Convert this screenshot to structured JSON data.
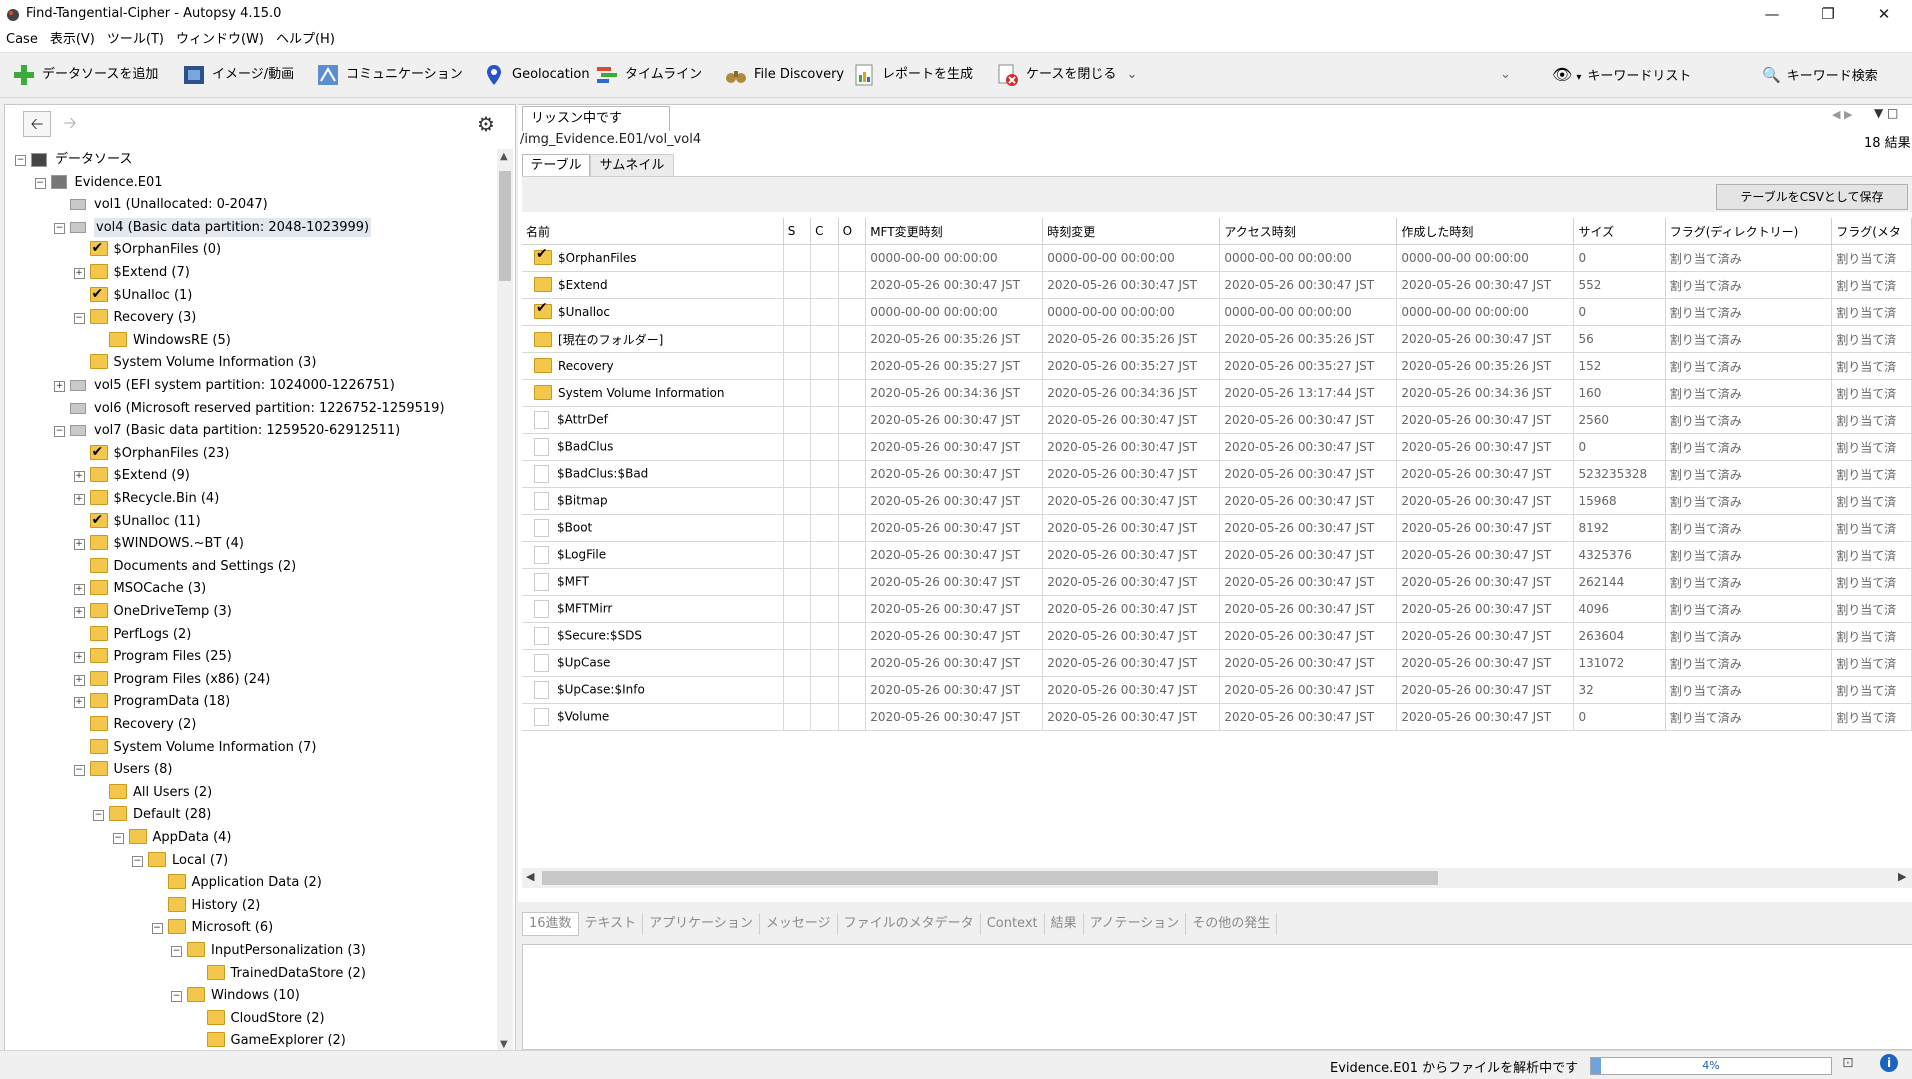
{
  "window": {
    "title": "Find-Tangential-Cipher - Autopsy 4.15.0"
  },
  "menu": [
    "Case",
    "表示(V)",
    "ツール(T)",
    "ウィンドウ(W)",
    "ヘルプ(H)"
  ],
  "toolbar": {
    "add_datasource": "データソースを追加",
    "images_videos": "イメージ/動画",
    "communications": "コミュニケーション",
    "geolocation": "Geolocation",
    "timeline": "タイムライン",
    "file_discovery": "File Discovery",
    "generate_report": "レポートを生成",
    "close_case": "ケースを閉じる",
    "keyword_list": "キーワードリスト",
    "keyword_search": "キーワード検索"
  },
  "tree": [
    {
      "label": "データソース",
      "depth": 0,
      "exp": "minus",
      "icon": "computer"
    },
    {
      "label": "Evidence.E01",
      "depth": 1,
      "exp": "minus",
      "icon": "image"
    },
    {
      "label": "vol1 (Unallocated: 0-2047)",
      "depth": 2,
      "exp": "",
      "icon": "volume"
    },
    {
      "label": "vol4 (Basic data partition: 2048-1023999)",
      "depth": 2,
      "exp": "minus",
      "icon": "volume",
      "selected": true
    },
    {
      "label": "$OrphanFiles (0)",
      "depth": 3,
      "exp": "",
      "icon": "vfolder"
    },
    {
      "label": "$Extend (7)",
      "depth": 3,
      "exp": "plus",
      "icon": "folder"
    },
    {
      "label": "$Unalloc (1)",
      "depth": 3,
      "exp": "",
      "icon": "vfolder"
    },
    {
      "label": "Recovery (3)",
      "depth": 3,
      "exp": "minus",
      "icon": "folder"
    },
    {
      "label": "WindowsRE (5)",
      "depth": 4,
      "exp": "",
      "icon": "folder"
    },
    {
      "label": "System Volume Information (3)",
      "depth": 3,
      "exp": "",
      "icon": "folder"
    },
    {
      "label": "vol5 (EFI system partition: 1024000-1226751)",
      "depth": 2,
      "exp": "plus",
      "icon": "volume"
    },
    {
      "label": "vol6 (Microsoft reserved partition: 1226752-1259519)",
      "depth": 2,
      "exp": "",
      "icon": "volume"
    },
    {
      "label": "vol7 (Basic data partition: 1259520-62912511)",
      "depth": 2,
      "exp": "minus",
      "icon": "volume"
    },
    {
      "label": "$OrphanFiles (23)",
      "depth": 3,
      "exp": "",
      "icon": "vfolder"
    },
    {
      "label": "$Extend (9)",
      "depth": 3,
      "exp": "plus",
      "icon": "folder"
    },
    {
      "label": "$Recycle.Bin (4)",
      "depth": 3,
      "exp": "plus",
      "icon": "folder"
    },
    {
      "label": "$Unalloc (11)",
      "depth": 3,
      "exp": "",
      "icon": "vfolder"
    },
    {
      "label": "$WINDOWS.~BT (4)",
      "depth": 3,
      "exp": "plus",
      "icon": "folder"
    },
    {
      "label": "Documents and Settings (2)",
      "depth": 3,
      "exp": "",
      "icon": "folder"
    },
    {
      "label": "MSOCache (3)",
      "depth": 3,
      "exp": "plus",
      "icon": "folder"
    },
    {
      "label": "OneDriveTemp (3)",
      "depth": 3,
      "exp": "plus",
      "icon": "folder"
    },
    {
      "label": "PerfLogs (2)",
      "depth": 3,
      "exp": "",
      "icon": "folder"
    },
    {
      "label": "Program Files (25)",
      "depth": 3,
      "exp": "plus",
      "icon": "folder"
    },
    {
      "label": "Program Files (x86) (24)",
      "depth": 3,
      "exp": "plus",
      "icon": "folder"
    },
    {
      "label": "ProgramData (18)",
      "depth": 3,
      "exp": "plus",
      "icon": "folder"
    },
    {
      "label": "Recovery (2)",
      "depth": 3,
      "exp": "",
      "icon": "folder"
    },
    {
      "label": "System Volume Information (7)",
      "depth": 3,
      "exp": "",
      "icon": "folder"
    },
    {
      "label": "Users (8)",
      "depth": 3,
      "exp": "minus",
      "icon": "folder"
    },
    {
      "label": "All Users (2)",
      "depth": 4,
      "exp": "",
      "icon": "folder"
    },
    {
      "label": "Default (28)",
      "depth": 4,
      "exp": "minus",
      "icon": "folder"
    },
    {
      "label": "AppData (4)",
      "depth": 5,
      "exp": "minus",
      "icon": "folder"
    },
    {
      "label": "Local (7)",
      "depth": 6,
      "exp": "minus",
      "icon": "folder"
    },
    {
      "label": "Application Data (2)",
      "depth": 7,
      "exp": "",
      "icon": "folder"
    },
    {
      "label": "History (2)",
      "depth": 7,
      "exp": "",
      "icon": "folder"
    },
    {
      "label": "Microsoft (6)",
      "depth": 7,
      "exp": "minus",
      "icon": "folder"
    },
    {
      "label": "InputPersonalization (3)",
      "depth": 8,
      "exp": "minus",
      "icon": "folder"
    },
    {
      "label": "TrainedDataStore (2)",
      "depth": 9,
      "exp": "",
      "icon": "folder"
    },
    {
      "label": "Windows (10)",
      "depth": 8,
      "exp": "minus",
      "icon": "folder"
    },
    {
      "label": "CloudStore (2)",
      "depth": 9,
      "exp": "",
      "icon": "folder"
    },
    {
      "label": "GameExplorer (2)",
      "depth": 9,
      "exp": "",
      "icon": "folder"
    }
  ],
  "result_viewer": {
    "tab_title": "リッスン中です",
    "path": "/img_Evidence.E01/vol_vol4",
    "result_count": "18 結果",
    "view_tabs": [
      "テーブル",
      "サムネイル"
    ],
    "save_csv": "テーブルをCSVとして保存",
    "columns": [
      "名前",
      "S",
      "C",
      "O",
      "MFT変更時刻",
      "時刻変更",
      "アクセス時刻",
      "作成した時刻",
      "サイズ",
      "フラグ(ディレクトリー)",
      "フラグ(メタ"
    ],
    "rows": [
      {
        "name": "$OrphanFiles",
        "icon": "vfolder",
        "mft": "0000-00-00 00:00:00",
        "mod": "0000-00-00 00:00:00",
        "acc": "0000-00-00 00:00:00",
        "cre": "0000-00-00 00:00:00",
        "size": "0",
        "flag": "割り当て済み",
        "flag2": "割り当て済"
      },
      {
        "name": "$Extend",
        "icon": "folder",
        "mft": "2020-05-26 00:30:47 JST",
        "mod": "2020-05-26 00:30:47 JST",
        "acc": "2020-05-26 00:30:47 JST",
        "cre": "2020-05-26 00:30:47 JST",
        "size": "552",
        "flag": "割り当て済み",
        "flag2": "割り当て済"
      },
      {
        "name": "$Unalloc",
        "icon": "vfolder",
        "mft": "0000-00-00 00:00:00",
        "mod": "0000-00-00 00:00:00",
        "acc": "0000-00-00 00:00:00",
        "cre": "0000-00-00 00:00:00",
        "size": "0",
        "flag": "割り当て済み",
        "flag2": "割り当て済"
      },
      {
        "name": "[現在のフォルダー]",
        "icon": "folder",
        "mft": "2020-05-26 00:35:26 JST",
        "mod": "2020-05-26 00:35:26 JST",
        "acc": "2020-05-26 00:35:26 JST",
        "cre": "2020-05-26 00:30:47 JST",
        "size": "56",
        "flag": "割り当て済み",
        "flag2": "割り当て済"
      },
      {
        "name": "Recovery",
        "icon": "folder",
        "mft": "2020-05-26 00:35:27 JST",
        "mod": "2020-05-26 00:35:27 JST",
        "acc": "2020-05-26 00:35:27 JST",
        "cre": "2020-05-26 00:35:26 JST",
        "size": "152",
        "flag": "割り当て済み",
        "flag2": "割り当て済"
      },
      {
        "name": "System Volume Information",
        "icon": "folder",
        "mft": "2020-05-26 00:34:36 JST",
        "mod": "2020-05-26 00:34:36 JST",
        "acc": "2020-05-26 13:17:44 JST",
        "cre": "2020-05-26 00:34:36 JST",
        "size": "160",
        "flag": "割り当て済み",
        "flag2": "割り当て済"
      },
      {
        "name": "$AttrDef",
        "icon": "file",
        "mft": "2020-05-26 00:30:47 JST",
        "mod": "2020-05-26 00:30:47 JST",
        "acc": "2020-05-26 00:30:47 JST",
        "cre": "2020-05-26 00:30:47 JST",
        "size": "2560",
        "flag": "割り当て済み",
        "flag2": "割り当て済"
      },
      {
        "name": "$BadClus",
        "icon": "file",
        "mft": "2020-05-26 00:30:47 JST",
        "mod": "2020-05-26 00:30:47 JST",
        "acc": "2020-05-26 00:30:47 JST",
        "cre": "2020-05-26 00:30:47 JST",
        "size": "0",
        "flag": "割り当て済み",
        "flag2": "割り当て済"
      },
      {
        "name": "$BadClus:$Bad",
        "icon": "file",
        "mft": "2020-05-26 00:30:47 JST",
        "mod": "2020-05-26 00:30:47 JST",
        "acc": "2020-05-26 00:30:47 JST",
        "cre": "2020-05-26 00:30:47 JST",
        "size": "523235328",
        "flag": "割り当て済み",
        "flag2": "割り当て済"
      },
      {
        "name": "$Bitmap",
        "icon": "file",
        "mft": "2020-05-26 00:30:47 JST",
        "mod": "2020-05-26 00:30:47 JST",
        "acc": "2020-05-26 00:30:47 JST",
        "cre": "2020-05-26 00:30:47 JST",
        "size": "15968",
        "flag": "割り当て済み",
        "flag2": "割り当て済"
      },
      {
        "name": "$Boot",
        "icon": "file",
        "mft": "2020-05-26 00:30:47 JST",
        "mod": "2020-05-26 00:30:47 JST",
        "acc": "2020-05-26 00:30:47 JST",
        "cre": "2020-05-26 00:30:47 JST",
        "size": "8192",
        "flag": "割り当て済み",
        "flag2": "割り当て済"
      },
      {
        "name": "$LogFile",
        "icon": "file",
        "mft": "2020-05-26 00:30:47 JST",
        "mod": "2020-05-26 00:30:47 JST",
        "acc": "2020-05-26 00:30:47 JST",
        "cre": "2020-05-26 00:30:47 JST",
        "size": "4325376",
        "flag": "割り当て済み",
        "flag2": "割り当て済"
      },
      {
        "name": "$MFT",
        "icon": "file",
        "mft": "2020-05-26 00:30:47 JST",
        "mod": "2020-05-26 00:30:47 JST",
        "acc": "2020-05-26 00:30:47 JST",
        "cre": "2020-05-26 00:30:47 JST",
        "size": "262144",
        "flag": "割り当て済み",
        "flag2": "割り当て済"
      },
      {
        "name": "$MFTMirr",
        "icon": "file",
        "mft": "2020-05-26 00:30:47 JST",
        "mod": "2020-05-26 00:30:47 JST",
        "acc": "2020-05-26 00:30:47 JST",
        "cre": "2020-05-26 00:30:47 JST",
        "size": "4096",
        "flag": "割り当て済み",
        "flag2": "割り当て済"
      },
      {
        "name": "$Secure:$SDS",
        "icon": "file",
        "mft": "2020-05-26 00:30:47 JST",
        "mod": "2020-05-26 00:30:47 JST",
        "acc": "2020-05-26 00:30:47 JST",
        "cre": "2020-05-26 00:30:47 JST",
        "size": "263604",
        "flag": "割り当て済み",
        "flag2": "割り当て済"
      },
      {
        "name": "$UpCase",
        "icon": "file",
        "mft": "2020-05-26 00:30:47 JST",
        "mod": "2020-05-26 00:30:47 JST",
        "acc": "2020-05-26 00:30:47 JST",
        "cre": "2020-05-26 00:30:47 JST",
        "size": "131072",
        "flag": "割り当て済み",
        "flag2": "割り当て済"
      },
      {
        "name": "$UpCase:$Info",
        "icon": "file",
        "mft": "2020-05-26 00:30:47 JST",
        "mod": "2020-05-26 00:30:47 JST",
        "acc": "2020-05-26 00:30:47 JST",
        "cre": "2020-05-26 00:30:47 JST",
        "size": "32",
        "flag": "割り当て済み",
        "flag2": "割り当て済"
      },
      {
        "name": "$Volume",
        "icon": "file",
        "mft": "2020-05-26 00:30:47 JST",
        "mod": "2020-05-26 00:30:47 JST",
        "acc": "2020-05-26 00:30:47 JST",
        "cre": "2020-05-26 00:30:47 JST",
        "size": "0",
        "flag": "割り当て済み",
        "flag2": "割り当て済"
      }
    ]
  },
  "content_viewer_tabs": [
    "16進数",
    "テキスト",
    "アプリケーション",
    "メッセージ",
    "ファイルのメタデータ",
    "Context",
    "結果",
    "アノテーション",
    "その他の発生"
  ],
  "status": {
    "text": "Evidence.E01 からファイルを解析中です",
    "progress": "4%",
    "progress_fraction": 0.04
  }
}
